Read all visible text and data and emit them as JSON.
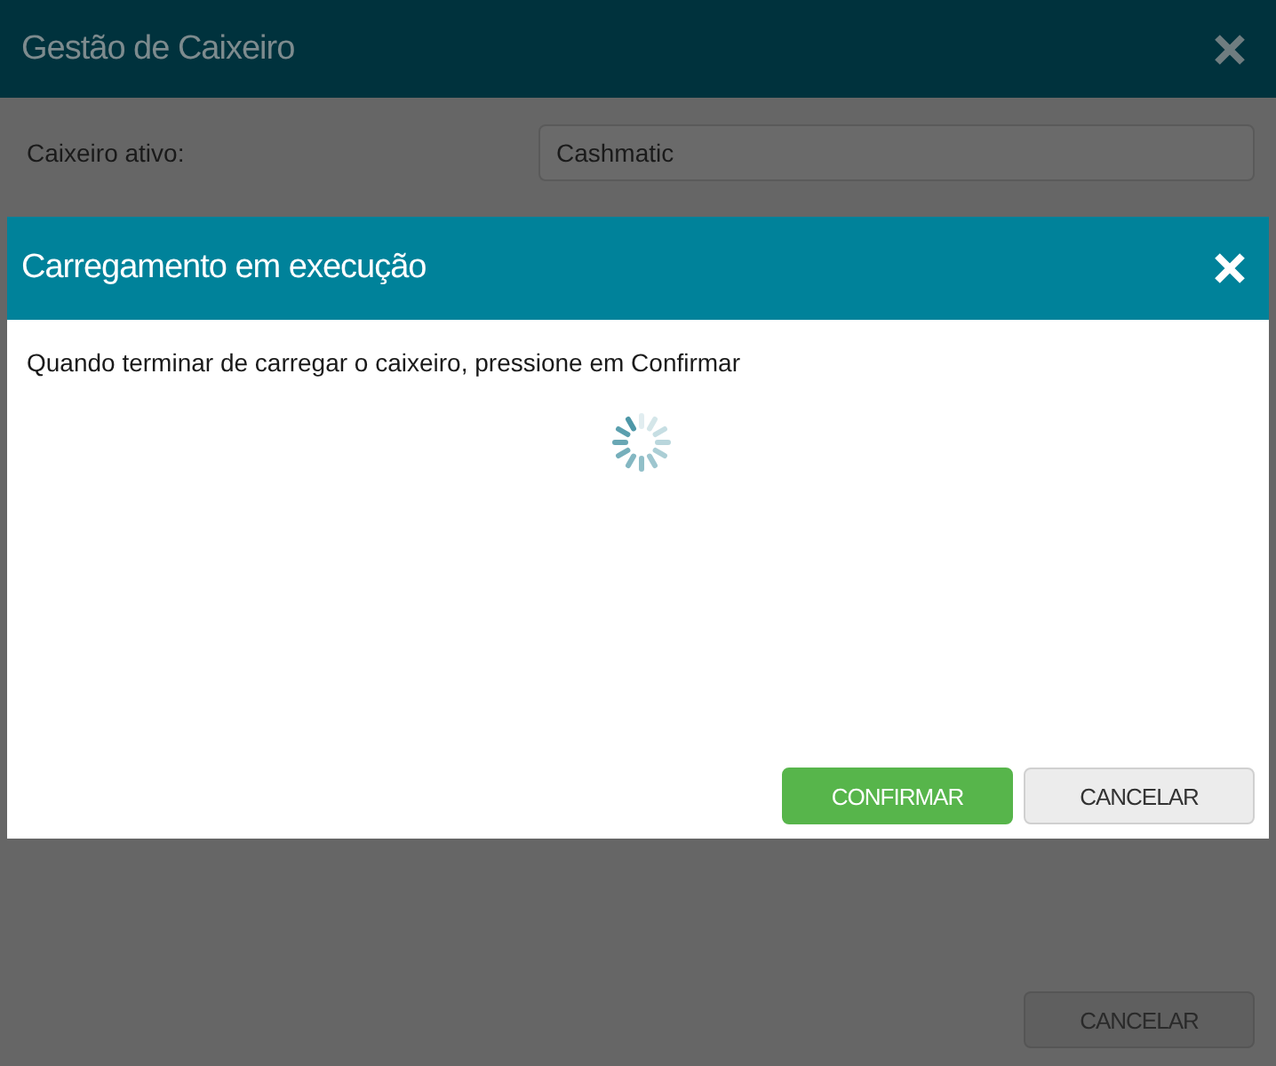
{
  "background_dialog": {
    "title": "Gestão de Caixeiro",
    "field": {
      "label": "Caixeiro ativo:",
      "value": "Cashmatic"
    },
    "buttons": [
      "CANCELAR"
    ]
  },
  "dialog": {
    "title": "Carregamento em execução",
    "message": "Quando terminar de carregar o caixeiro, pressione em Confirmar",
    "buttons": [
      {
        "label": "CONFIRMAR",
        "kind": "primary"
      },
      {
        "label": "CANCELAR",
        "kind": "secondary"
      }
    ]
  }
}
